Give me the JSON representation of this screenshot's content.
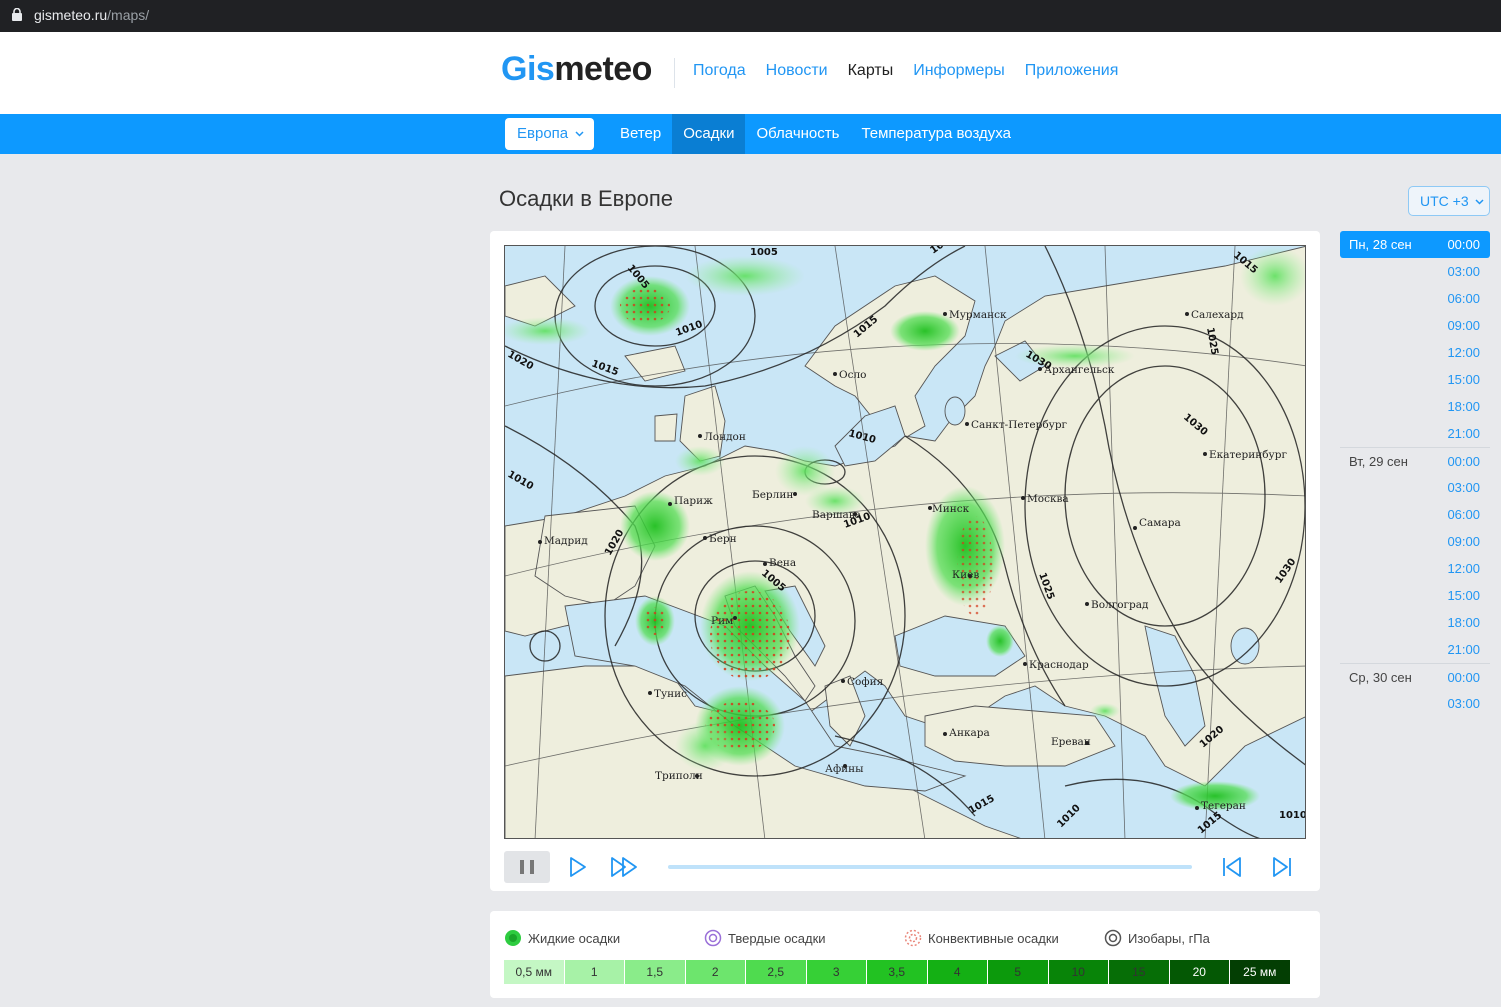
{
  "browser": {
    "url_host": "gismeteo.ru",
    "url_path": "/maps/"
  },
  "header": {
    "logo_part1": "Gis",
    "logo_part2": "meteo",
    "nav": [
      {
        "label": "Погода",
        "active": false
      },
      {
        "label": "Новости",
        "active": false
      },
      {
        "label": "Карты",
        "active": true
      },
      {
        "label": "Информеры",
        "active": false
      },
      {
        "label": "Приложения",
        "active": false
      }
    ]
  },
  "subnav": {
    "region": "Европа",
    "tabs": [
      {
        "label": "Ветер",
        "active": false
      },
      {
        "label": "Осадки",
        "active": true
      },
      {
        "label": "Облачность",
        "active": false
      },
      {
        "label": "Температура воздуха",
        "active": false
      }
    ]
  },
  "page": {
    "title": "Осадки в Европе",
    "timezone": "UTC +3"
  },
  "map": {
    "cities": [
      "Салехард",
      "Мурманск",
      "Архангельск",
      "Осло",
      "Санкт-Петербург",
      "Екатеринбург",
      "Лондон",
      "Берлин",
      "Варшава",
      "Минск",
      "Москва",
      "Самара",
      "Париж",
      "Берн",
      "Мадрид",
      "Вена",
      "Киев",
      "Волгоград",
      "Рим",
      "Краснодар",
      "София",
      "Тунис",
      "Анкара",
      "Ереван",
      "Афины",
      "Триполи",
      "Тегеран"
    ],
    "isobars": [
      "1005",
      "1005",
      "1010",
      "1015",
      "1015",
      "1020",
      "1010",
      "1010",
      "1015",
      "1030",
      "1025",
      "1030",
      "1015",
      "1025",
      "1020",
      "1010",
      "1005",
      "1030",
      "1020",
      "1015",
      "1010",
      "1015",
      "1010"
    ]
  },
  "controls": {
    "pause": "pause-icon",
    "play": "play-icon",
    "fast_forward": "fast-forward-icon",
    "to_start": "skip-start-icon",
    "to_end": "skip-end-icon",
    "progress": 0.0
  },
  "timeline": [
    {
      "day": "Пн, 28 сен",
      "time": "00:00",
      "selected": true
    },
    {
      "day": "",
      "time": "03:00"
    },
    {
      "day": "",
      "time": "06:00"
    },
    {
      "day": "",
      "time": "09:00"
    },
    {
      "day": "",
      "time": "12:00"
    },
    {
      "day": "",
      "time": "15:00"
    },
    {
      "day": "",
      "time": "18:00"
    },
    {
      "day": "",
      "time": "21:00"
    },
    {
      "day": "Вт, 29 сен",
      "time": "00:00"
    },
    {
      "day": "",
      "time": "03:00"
    },
    {
      "day": "",
      "time": "06:00"
    },
    {
      "day": "",
      "time": "09:00"
    },
    {
      "day": "",
      "time": "12:00"
    },
    {
      "day": "",
      "time": "15:00"
    },
    {
      "day": "",
      "time": "18:00"
    },
    {
      "day": "",
      "time": "21:00"
    },
    {
      "day": "Ср, 30 сен",
      "time": "00:00"
    },
    {
      "day": "",
      "time": "03:00"
    }
  ],
  "legend": {
    "items": [
      {
        "label": "Жидкие осадки",
        "icon": "liquid-precip-icon"
      },
      {
        "label": "Твердые осадки",
        "icon": "solid-precip-icon"
      },
      {
        "label": "Конвективные осадки",
        "icon": "convective-precip-icon"
      },
      {
        "label": "Изобары, гПа",
        "icon": "isobar-icon"
      }
    ],
    "scale": [
      {
        "label": "0,5 мм",
        "color": "#c4f7c4"
      },
      {
        "label": "1",
        "color": "#a7f2a7"
      },
      {
        "label": "1,5",
        "color": "#8aec8a"
      },
      {
        "label": "2",
        "color": "#6de56d"
      },
      {
        "label": "2,5",
        "color": "#4fdb4f"
      },
      {
        "label": "3",
        "color": "#36d036"
      },
      {
        "label": "3,5",
        "color": "#22c222"
      },
      {
        "label": "4",
        "color": "#14b014"
      },
      {
        "label": "5",
        "color": "#0c9a0c"
      },
      {
        "label": "10",
        "color": "#088408"
      },
      {
        "label": "15",
        "color": "#066e06"
      },
      {
        "label": "20",
        "color": "#045804"
      },
      {
        "label": "25 мм",
        "color": "#033e03"
      }
    ]
  }
}
